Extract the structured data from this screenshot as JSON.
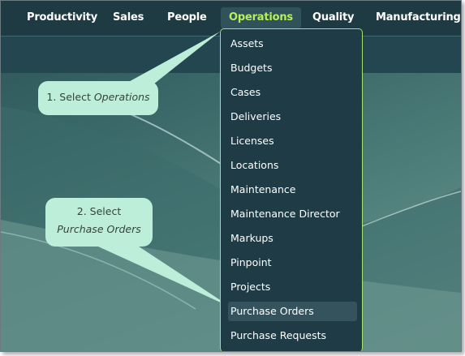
{
  "nav": {
    "items": [
      {
        "label": "Productivity"
      },
      {
        "label": "Sales"
      },
      {
        "label": "People"
      },
      {
        "label": "Operations"
      },
      {
        "label": "Quality"
      },
      {
        "label": "Manufacturing"
      }
    ],
    "active": "Operations"
  },
  "dropdown": {
    "items": [
      "Assets",
      "Budgets",
      "Cases",
      "Deliveries",
      "Licenses",
      "Locations",
      "Maintenance",
      "Maintenance Director",
      "Markups",
      "Pinpoint",
      "Projects",
      "Purchase Orders",
      "Purchase Requests"
    ],
    "highlighted": "Purchase Orders"
  },
  "callouts": {
    "step1": {
      "prefix": "1. Select ",
      "target": "Operations"
    },
    "step2": {
      "line1": "2. Select",
      "target": "Purchase Orders"
    }
  },
  "colors": {
    "accent": "#b7f05a",
    "callout": "#bdeed9",
    "menu_bg": "#1f3c46",
    "bar_bg": "#1e3b44"
  }
}
